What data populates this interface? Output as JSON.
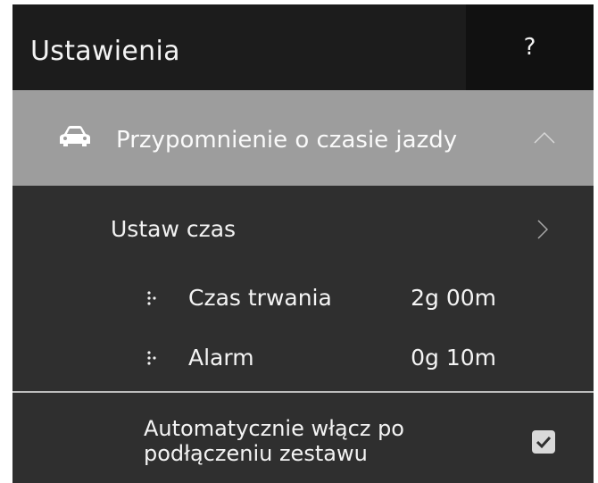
{
  "header": {
    "title": "Ustawienia",
    "help_label": "?"
  },
  "section": {
    "label": "Przypomnienie o czasie jazdy",
    "icon": "car-icon",
    "expanded": true
  },
  "set_time": {
    "label": "Ustaw czas",
    "icon": "chevron-right-icon"
  },
  "info": [
    {
      "name": "Czas trwania",
      "value": "2g 00m",
      "icon": "dots-icon"
    },
    {
      "name": "Alarm",
      "value": "0g 10m",
      "icon": "dots-icon"
    }
  ],
  "auto": {
    "label_line1": "Automatycznie włącz po",
    "label_line2": "podłączeniu zestawu",
    "checked": true
  },
  "colors": {
    "header_bg": "#1c1c1c",
    "help_bg": "#111111",
    "section_bg": "#9d9d9d",
    "body_bg": "#2f2f2f",
    "text": "#f2f2f2"
  }
}
